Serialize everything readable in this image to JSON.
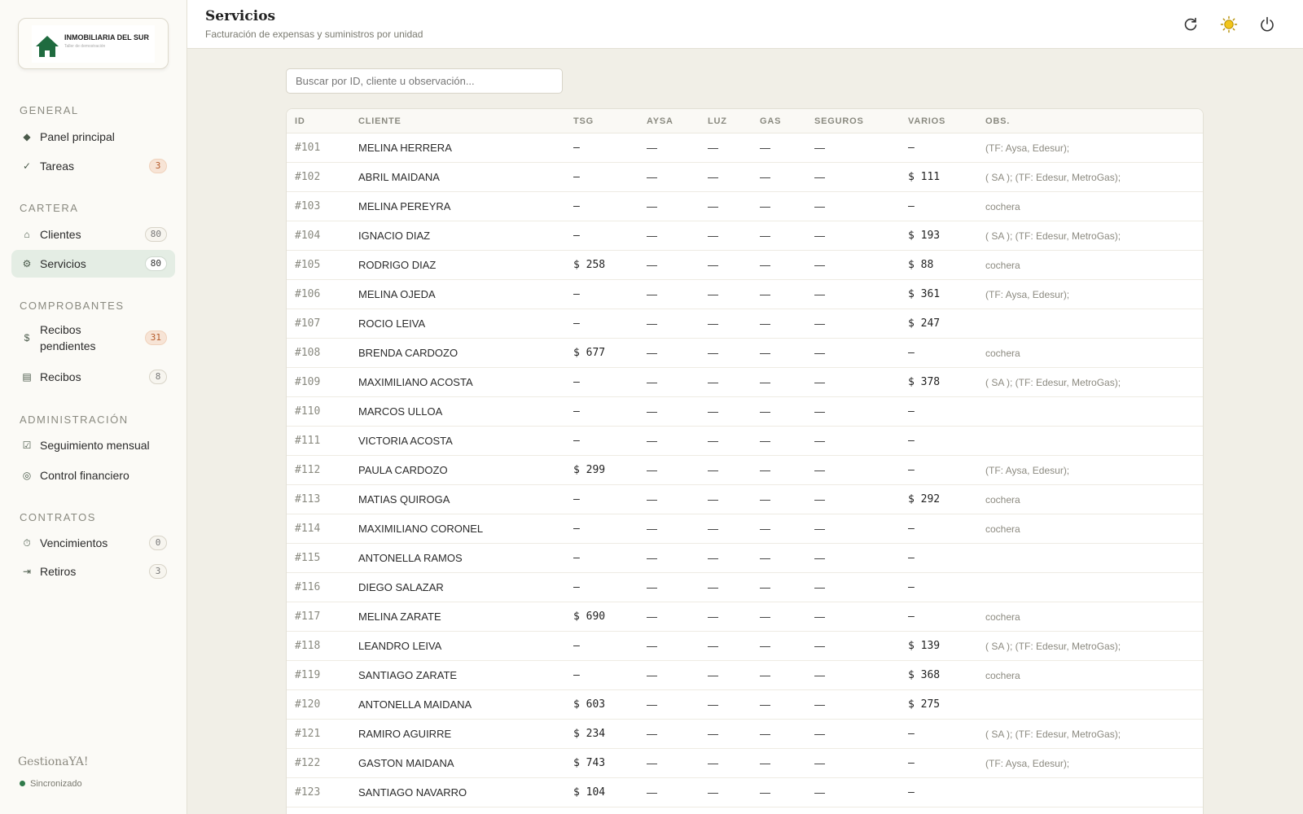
{
  "sidebar": {
    "logo": {
      "title": "INMOBILIARIA DEL SUR",
      "subtitle": "Taller de demostración"
    },
    "sections": [
      {
        "title": "GENERAL",
        "items": [
          {
            "label": "Panel principal",
            "icon": "diamond-icon",
            "glyph": "◆"
          },
          {
            "label": "Tareas",
            "icon": "check-icon",
            "glyph": "✓",
            "badge": "3",
            "badge_style": "warn"
          }
        ]
      },
      {
        "title": "CARTERA",
        "items": [
          {
            "label": "Clientes",
            "icon": "home-icon",
            "glyph": "⌂",
            "badge": "80"
          },
          {
            "label": "Servicios",
            "icon": "gear-icon",
            "glyph": "⚙",
            "badge": "80",
            "active": true
          }
        ]
      },
      {
        "title": "COMPROBANTES",
        "items": [
          {
            "label": "Recibos pendientes",
            "icon": "dollar-icon",
            "glyph": "$",
            "badge": "31",
            "badge_style": "warn"
          },
          {
            "label": "Recibos",
            "icon": "receipt-icon",
            "glyph": "▤",
            "badge": "8"
          }
        ]
      },
      {
        "title": "ADMINISTRACIÓN",
        "items": [
          {
            "label": "Seguimiento mensual",
            "icon": "checkbox-icon",
            "glyph": "☑"
          },
          {
            "label": "Control financiero",
            "icon": "target-icon",
            "glyph": "◎"
          }
        ]
      },
      {
        "title": "CONTRATOS",
        "items": [
          {
            "label": "Vencimientos",
            "icon": "timer-icon",
            "glyph": "⏱",
            "badge": "0"
          },
          {
            "label": "Retiros",
            "icon": "exit-icon",
            "glyph": "⇥",
            "badge": "3"
          }
        ]
      }
    ],
    "brand": "GestionaYA!",
    "sync_status": "Sincronizado"
  },
  "header": {
    "title": "Servicios",
    "subtitle": "Facturación de expensas y suministros por unidad",
    "actions": [
      "refresh-icon",
      "theme-sun-icon",
      "power-icon"
    ]
  },
  "search": {
    "placeholder": "Buscar por ID, cliente u observación..."
  },
  "table": {
    "columns": [
      "ID",
      "CLIENTE",
      "TSG",
      "AYSA",
      "LUZ",
      "GAS",
      "SEGUROS",
      "VARIOS",
      "OBS."
    ],
    "rows": [
      {
        "id": "#101",
        "cliente": "MELINA HERRERA",
        "tsg": "—",
        "aysa": "—",
        "luz": "—",
        "gas": "—",
        "seguros": "—",
        "varios": "—",
        "obs": "(TF: Aysa, Edesur);"
      },
      {
        "id": "#102",
        "cliente": "ABRIL MAIDANA",
        "tsg": "—",
        "aysa": "—",
        "luz": "—",
        "gas": "—",
        "seguros": "—",
        "varios": "$ 111",
        "obs": "( SA ); (TF: Edesur, MetroGas);"
      },
      {
        "id": "#103",
        "cliente": "MELINA PEREYRA",
        "tsg": "—",
        "aysa": "—",
        "luz": "—",
        "gas": "—",
        "seguros": "—",
        "varios": "—",
        "obs": "cochera"
      },
      {
        "id": "#104",
        "cliente": "IGNACIO DIAZ",
        "tsg": "—",
        "aysa": "—",
        "luz": "—",
        "gas": "—",
        "seguros": "—",
        "varios": "$ 193",
        "obs": "( SA ); (TF: Edesur, MetroGas);"
      },
      {
        "id": "#105",
        "cliente": "RODRIGO DIAZ",
        "tsg": "$ 258",
        "aysa": "—",
        "luz": "—",
        "gas": "—",
        "seguros": "—",
        "varios": "$ 88",
        "obs": "cochera"
      },
      {
        "id": "#106",
        "cliente": "MELINA OJEDA",
        "tsg": "—",
        "aysa": "—",
        "luz": "—",
        "gas": "—",
        "seguros": "—",
        "varios": "$ 361",
        "obs": "(TF: Aysa, Edesur);"
      },
      {
        "id": "#107",
        "cliente": "ROCIO LEIVA",
        "tsg": "—",
        "aysa": "—",
        "luz": "—",
        "gas": "—",
        "seguros": "—",
        "varios": "$ 247",
        "obs": ""
      },
      {
        "id": "#108",
        "cliente": "BRENDA CARDOZO",
        "tsg": "$ 677",
        "aysa": "—",
        "luz": "—",
        "gas": "—",
        "seguros": "—",
        "varios": "—",
        "obs": "cochera"
      },
      {
        "id": "#109",
        "cliente": "MAXIMILIANO ACOSTA",
        "tsg": "—",
        "aysa": "—",
        "luz": "—",
        "gas": "—",
        "seguros": "—",
        "varios": "$ 378",
        "obs": "( SA ); (TF: Edesur, MetroGas);"
      },
      {
        "id": "#110",
        "cliente": "MARCOS ULLOA",
        "tsg": "—",
        "aysa": "—",
        "luz": "—",
        "gas": "—",
        "seguros": "—",
        "varios": "—",
        "obs": ""
      },
      {
        "id": "#111",
        "cliente": "VICTORIA ACOSTA",
        "tsg": "—",
        "aysa": "—",
        "luz": "—",
        "gas": "—",
        "seguros": "—",
        "varios": "—",
        "obs": ""
      },
      {
        "id": "#112",
        "cliente": "PAULA CARDOZO",
        "tsg": "$ 299",
        "aysa": "—",
        "luz": "—",
        "gas": "—",
        "seguros": "—",
        "varios": "—",
        "obs": "(TF: Aysa, Edesur);"
      },
      {
        "id": "#113",
        "cliente": "MATIAS QUIROGA",
        "tsg": "—",
        "aysa": "—",
        "luz": "—",
        "gas": "—",
        "seguros": "—",
        "varios": "$ 292",
        "obs": "cochera"
      },
      {
        "id": "#114",
        "cliente": "MAXIMILIANO CORONEL",
        "tsg": "—",
        "aysa": "—",
        "luz": "—",
        "gas": "—",
        "seguros": "—",
        "varios": "—",
        "obs": "cochera"
      },
      {
        "id": "#115",
        "cliente": "ANTONELLA RAMOS",
        "tsg": "—",
        "aysa": "—",
        "luz": "—",
        "gas": "—",
        "seguros": "—",
        "varios": "—",
        "obs": ""
      },
      {
        "id": "#116",
        "cliente": "DIEGO SALAZAR",
        "tsg": "—",
        "aysa": "—",
        "luz": "—",
        "gas": "—",
        "seguros": "—",
        "varios": "—",
        "obs": ""
      },
      {
        "id": "#117",
        "cliente": "MELINA ZARATE",
        "tsg": "$ 690",
        "aysa": "—",
        "luz": "—",
        "gas": "—",
        "seguros": "—",
        "varios": "—",
        "obs": "cochera"
      },
      {
        "id": "#118",
        "cliente": "LEANDRO LEIVA",
        "tsg": "—",
        "aysa": "—",
        "luz": "—",
        "gas": "—",
        "seguros": "—",
        "varios": "$ 139",
        "obs": "( SA ); (TF: Edesur, MetroGas);"
      },
      {
        "id": "#119",
        "cliente": "SANTIAGO ZARATE",
        "tsg": "—",
        "aysa": "—",
        "luz": "—",
        "gas": "—",
        "seguros": "—",
        "varios": "$ 368",
        "obs": "cochera"
      },
      {
        "id": "#120",
        "cliente": "ANTONELLA MAIDANA",
        "tsg": "$ 603",
        "aysa": "—",
        "luz": "—",
        "gas": "—",
        "seguros": "—",
        "varios": "$ 275",
        "obs": ""
      },
      {
        "id": "#121",
        "cliente": "RAMIRO AGUIRRE",
        "tsg": "$ 234",
        "aysa": "—",
        "luz": "—",
        "gas": "—",
        "seguros": "—",
        "varios": "—",
        "obs": "( SA ); (TF: Edesur, MetroGas);"
      },
      {
        "id": "#122",
        "cliente": "GASTON MAIDANA",
        "tsg": "$ 743",
        "aysa": "—",
        "luz": "—",
        "gas": "—",
        "seguros": "—",
        "varios": "—",
        "obs": "(TF: Aysa, Edesur);"
      },
      {
        "id": "#123",
        "cliente": "SANTIAGO NAVARRO",
        "tsg": "$ 104",
        "aysa": "—",
        "luz": "—",
        "gas": "—",
        "seguros": "—",
        "varios": "—",
        "obs": ""
      }
    ]
  },
  "colors": {
    "accent": "#2f6b45",
    "active_bg": "#e4ede4",
    "warn_badge": "#f7e4d6",
    "page_bg": "#f1efe7"
  }
}
